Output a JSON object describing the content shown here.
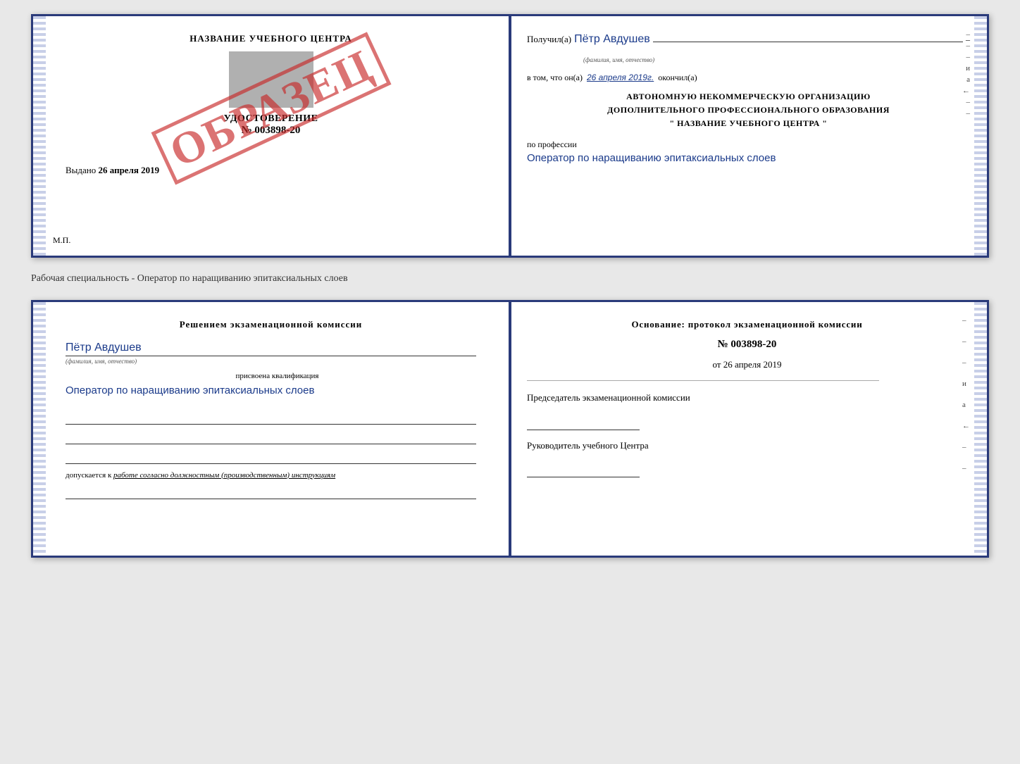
{
  "page": {
    "background": "#e8e8e8"
  },
  "cert": {
    "left": {
      "title": "НАЗВАНИЕ УЧЕБНОГО ЦЕНТРА",
      "document_label": "УДОСТОВЕРЕНИЕ",
      "document_number": "№ 003898-20",
      "stamp_text": "ОБРАЗЕЦ",
      "vydano_prefix": "Выдано",
      "vydano_date": "26 апреля 2019",
      "mp_label": "М.П."
    },
    "right": {
      "poluchil_prefix": "Получил(а)",
      "poluchil_name": "Пётр Авдушев",
      "fio_label": "(фамилия, имя, отчество)",
      "vtom_prefix": "в том, что он(а)",
      "vtom_date": "26 апреля 2019г.",
      "okoncil": "окончил(а)",
      "org_line1": "АВТОНОМНУЮ НЕКОММЕРЧЕСКУЮ ОРГАНИЗАЦИЮ",
      "org_line2": "ДОПОЛНИТЕЛЬНОГО ПРОФЕССИОНАЛЬНОГО ОБРАЗОВАНИЯ",
      "org_line3": "\" НАЗВАНИЕ УЧЕБНОГО ЦЕНТРА \"",
      "prof_label": "по профессии",
      "prof_name": "Оператор по наращиванию эпитаксиальных слоев",
      "dash1": "–",
      "dash2": "–",
      "dash3": "–",
      "dash4": "и",
      "dash5": "а",
      "dash6": "←",
      "dash7": "–",
      "dash8": "–"
    }
  },
  "subtitle": "Рабочая специальность - Оператор по наращиванию эпитаксиальных слоев",
  "qual": {
    "left": {
      "resheniem_title": "Решением экзаменационной комиссии",
      "name": "Пётр Авдушев",
      "fio_label": "(фамилия, имя, отчество)",
      "prisvoena": "присвоена квалификация",
      "qualification": "Оператор по наращиванию эпитаксиальных слоев",
      "dopuskaetsya": "допускается к",
      "dopusk_text": "работе согласно должностным (производственным) инструкциям"
    },
    "right": {
      "osnovanie": "Основание: протокол экзаменационной комиссии",
      "number": "№ 003898-20",
      "ot_prefix": "от",
      "date": "26 апреля 2019",
      "predsedatel_label": "Председатель экзаменационной комиссии",
      "rukov_label": "Руководитель учебного Центра",
      "dash1": "–",
      "dash2": "–",
      "dash3": "–",
      "dash4": "и",
      "dash5": "а",
      "dash6": "←",
      "dash7": "–",
      "dash8": "–"
    }
  }
}
